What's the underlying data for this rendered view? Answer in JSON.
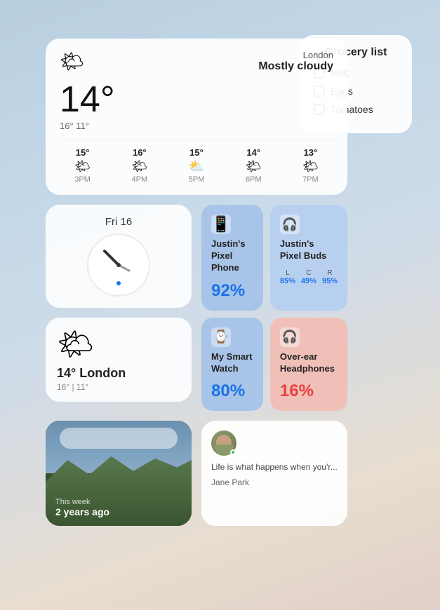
{
  "weather": {
    "location": "London",
    "description": "Mostly cloudy",
    "temp_main": "14°",
    "hi": "16°",
    "low": "11°",
    "icon": "🌤",
    "forecast": [
      {
        "time": "3PM",
        "temp": "15°",
        "icon": "🌤"
      },
      {
        "time": "4PM",
        "temp": "16°",
        "icon": "🌤"
      },
      {
        "time": "5PM",
        "temp": "15°",
        "icon": "⛅"
      },
      {
        "time": "6PM",
        "temp": "14°",
        "icon": "🌤"
      },
      {
        "time": "7PM",
        "temp": "13°",
        "icon": "🌤"
      }
    ]
  },
  "clock": {
    "date": "Fri 16"
  },
  "small_weather": {
    "icon": "🌤",
    "temp": "14° London",
    "hi_low": "16° | 11°"
  },
  "grocery": {
    "title": "Grocery list",
    "items": [
      "Milk",
      "Eggs",
      "Tomatoes"
    ]
  },
  "devices": [
    {
      "name": "Justin's Pixel Phone",
      "icon": "📱",
      "battery": "92%",
      "color": "blue"
    },
    {
      "name": "Justin's Pixel Buds",
      "icon": "🎧",
      "battery": null,
      "channels": [
        {
          "label": "L",
          "val": "85%"
        },
        {
          "label": "C",
          "val": "49%"
        },
        {
          "label": "R",
          "val": "95%"
        }
      ],
      "color": "blue-light"
    },
    {
      "name": "My Smart Watch",
      "icon": "⌚",
      "battery": "80%",
      "color": "blue"
    },
    {
      "name": "Over-ear Headphones",
      "icon": "🎧",
      "battery": "16%",
      "color": "pink",
      "battery_red": true
    }
  ],
  "photos": {
    "time_label": "This week",
    "ago_label": "2 years ago"
  },
  "message": {
    "text": "Life is what happens when you'r...",
    "sender": "Jane Park",
    "online": true
  }
}
